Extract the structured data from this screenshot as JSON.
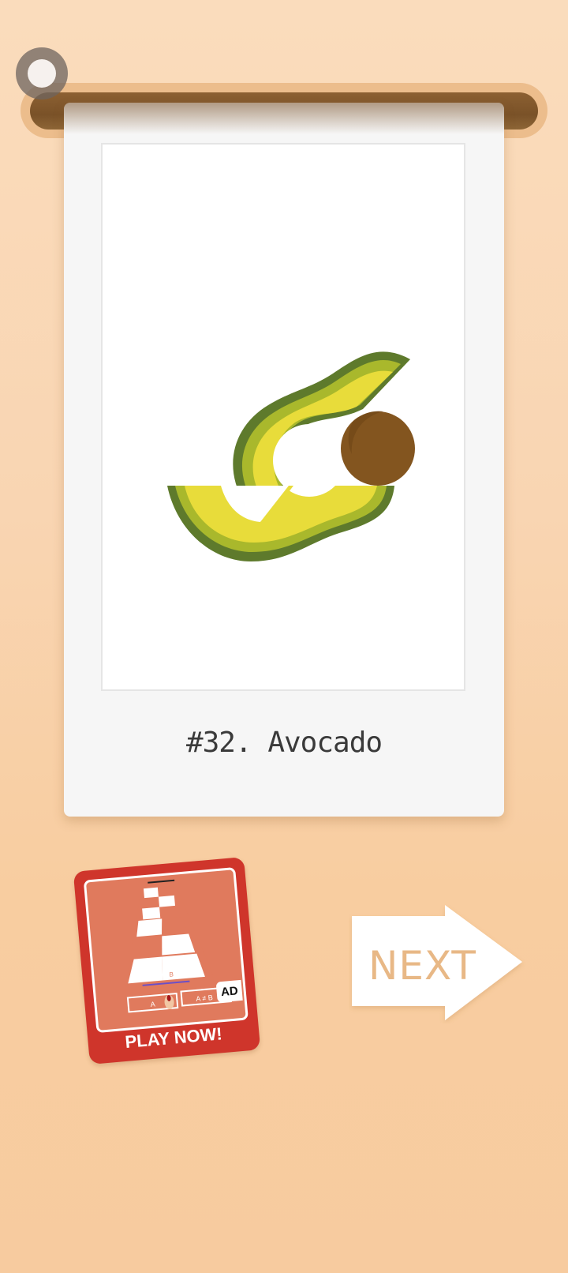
{
  "card": {
    "caption": "#32. Avocado"
  },
  "ad": {
    "badge": "AD",
    "cta": "PLAY NOW!",
    "tile_labels": {
      "left": "A",
      "right": "A ≠ B",
      "center": "B"
    }
  },
  "navigation": {
    "next_label": "NEXT"
  },
  "colors": {
    "background": "#f9d5b2",
    "rod": "#7a5228",
    "avocado_skin": "#5e7a2c",
    "avocado_mid": "#a9b82c",
    "avocado_flesh": "#e8dc3a",
    "avocado_pit": "#83551f",
    "ad_red": "#cf352b",
    "next_text": "#e8b886"
  },
  "icons": {
    "back": "circle-button-icon",
    "next": "arrow-right-icon"
  }
}
